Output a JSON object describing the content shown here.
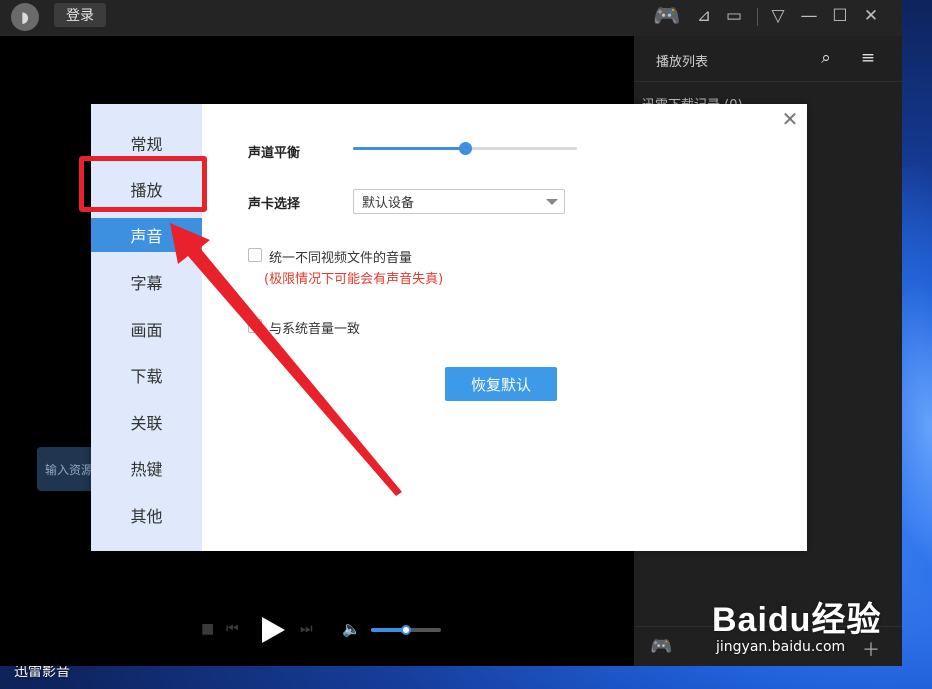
{
  "titlebar": {
    "login_label": "登录"
  },
  "playlist": {
    "title": "播放列表",
    "folder": "迅雷下载记录 (0)"
  },
  "input_resource": "输入资源",
  "desktop_label": "迅雷影音",
  "dialog": {
    "nav": [
      "常规",
      "播放",
      "声音",
      "字幕",
      "画面",
      "下载",
      "关联",
      "热键",
      "其他"
    ],
    "active_index": 2,
    "balance_label": "声道平衡",
    "balance_value": 0.5,
    "soundcard_label": "声卡选择",
    "soundcard_value": "默认设备",
    "unify_volume_label": "统一不同视频文件的音量",
    "unify_volume_warning": "(极限情况下可能会有声音失真)",
    "system_volume_label": "与系统音量一致",
    "restore_label": "恢复默认"
  },
  "volume_level": 0.5,
  "watermark": {
    "main": "Baidu经验",
    "sub": "jingyan.baidu.com"
  },
  "colors": {
    "accent": "#3d8fe0",
    "annotation": "#e8212a",
    "warning": "#e53b2c"
  }
}
